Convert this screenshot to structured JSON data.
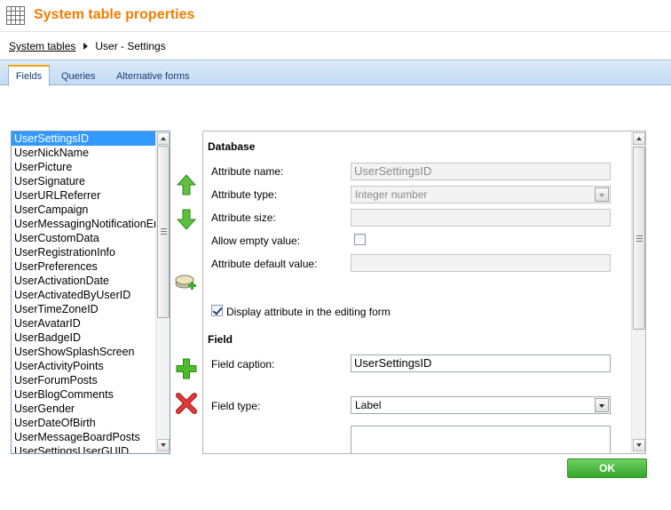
{
  "header": {
    "title": "System table properties",
    "icon": "table-grid-icon"
  },
  "breadcrumb": {
    "link": "System tables",
    "current": "User - Settings"
  },
  "tabs": [
    {
      "label": "Fields",
      "active": true
    },
    {
      "label": "Queries",
      "active": false
    },
    {
      "label": "Alternative forms",
      "active": false
    }
  ],
  "fields_list": {
    "selected": "UserSettingsID",
    "items": [
      "UserSettingsID",
      "UserNickName",
      "UserPicture",
      "UserSignature",
      "UserURLReferrer",
      "UserCampaign",
      "UserMessagingNotificationEmail",
      "UserCustomData",
      "UserRegistrationInfo",
      "UserPreferences",
      "UserActivationDate",
      "UserActivatedByUserID",
      "UserTimeZoneID",
      "UserAvatarID",
      "UserBadgeID",
      "UserShowSplashScreen",
      "UserActivityPoints",
      "UserForumPosts",
      "UserBlogComments",
      "UserGender",
      "UserDateOfBirth",
      "UserMessageBoardPosts",
      "UserSettingsUserGUID"
    ]
  },
  "actions": {
    "move_up": "arrow-up-icon",
    "move_down": "arrow-down-icon",
    "new_category": "new-category-icon",
    "add_field": "plus-icon",
    "delete_field": "delete-x-icon"
  },
  "database": {
    "section_title": "Database",
    "attribute_name_label": "Attribute name:",
    "attribute_name_value": "UserSettingsID",
    "attribute_type_label": "Attribute type:",
    "attribute_type_value": "Integer number",
    "attribute_size_label": "Attribute size:",
    "attribute_size_value": "",
    "allow_empty_label": "Allow empty value:",
    "allow_empty_checked": false,
    "default_value_label": "Attribute default value:",
    "default_value": "",
    "display_in_form_label": "Display attribute in the editing form",
    "display_in_form_checked": true
  },
  "field": {
    "section_title": "Field",
    "caption_label": "Field caption:",
    "caption_value": "UserSettingsID",
    "type_label": "Field type:",
    "type_value": "Label"
  },
  "ok_button": "OK",
  "colors": {
    "title_orange": "#f27c00",
    "tab_accent": "#f6a400",
    "selection_blue": "#3399ff",
    "ok_green": "#35a82b"
  }
}
